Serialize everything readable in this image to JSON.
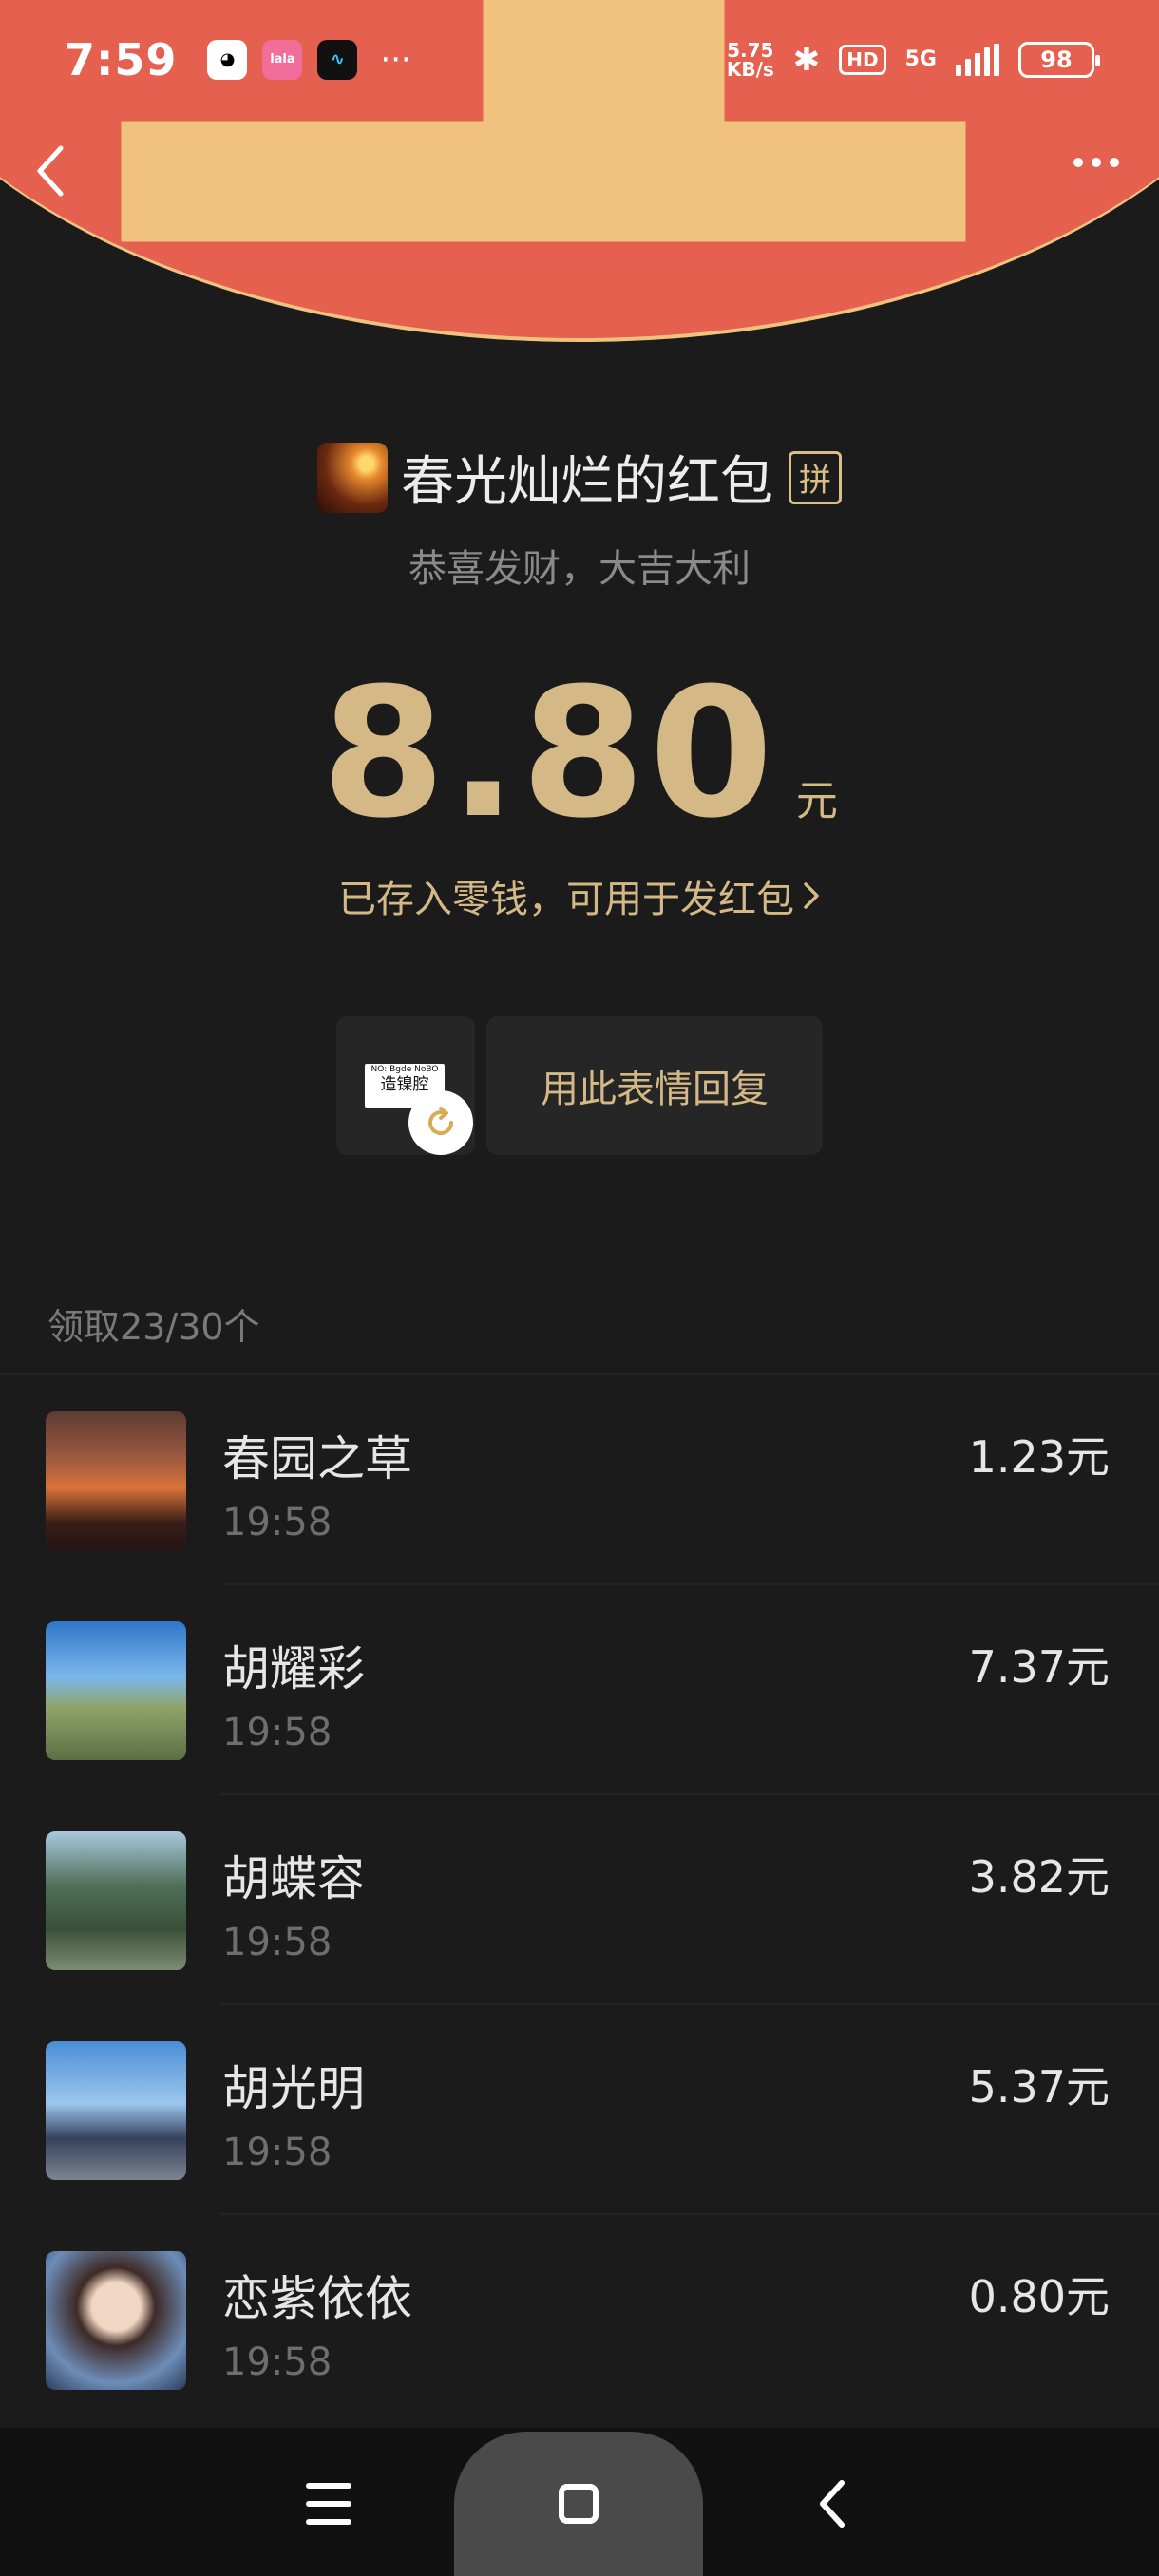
{
  "status_bar": {
    "time": "7:59",
    "net_speed_top": "5.75",
    "net_speed_bottom": "KB/s",
    "hd": "HD",
    "network": "5G",
    "battery": "98",
    "more": "···"
  },
  "header": {
    "title": "春光灿烂的红包",
    "pin_badge": "拼",
    "blessing": "恭喜发财，大吉大利"
  },
  "amount": {
    "value": "8.80",
    "unit": "元",
    "stored_note": "已存入零钱，可用于发红包"
  },
  "sticker_reply": {
    "sticker_small_text": "NO: Bgde NoBO",
    "sticker_text": "造镍腔",
    "reply_label": "用此表情回复"
  },
  "claimed_count": "领取23/30个",
  "recipients": [
    {
      "name": "春园之草",
      "time": "19:58",
      "amount": "1.23元"
    },
    {
      "name": "胡耀彩",
      "time": "19:58",
      "amount": "7.37元"
    },
    {
      "name": "胡蝶容",
      "time": "19:58",
      "amount": "3.82元"
    },
    {
      "name": "胡光明",
      "time": "19:58",
      "amount": "5.37元"
    },
    {
      "name": "恋紫依依",
      "time": "19:58",
      "amount": "0.80元"
    }
  ],
  "colors": {
    "header_red": "#e5604f",
    "gold": "#d4b987",
    "background": "#1b1b1b"
  }
}
